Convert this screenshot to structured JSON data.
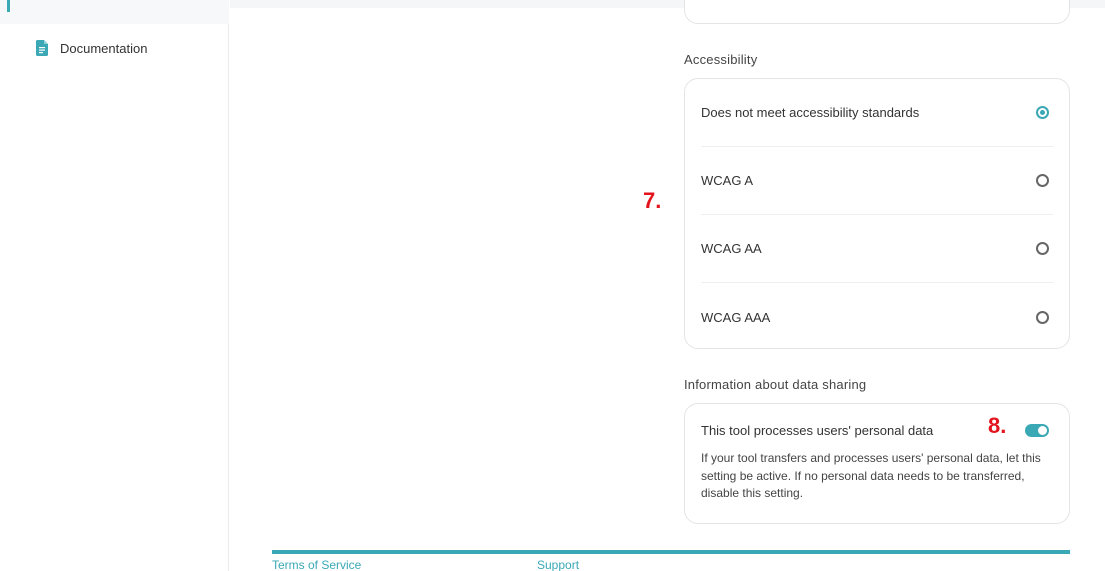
{
  "sidebar": {
    "items": [
      {
        "label": "Documentation",
        "icon": "document-icon"
      }
    ]
  },
  "accessibility": {
    "label": "Accessibility",
    "options": [
      {
        "label": "Does not meet accessibility standards",
        "selected": true
      },
      {
        "label": "WCAG A",
        "selected": false
      },
      {
        "label": "WCAG AA",
        "selected": false
      },
      {
        "label": "WCAG AAA",
        "selected": false
      }
    ]
  },
  "data_sharing": {
    "label": "Information about data sharing",
    "title": "This tool processes users' personal data",
    "toggle_on": true,
    "description": "If your tool transfers and processes users' personal data, let this setting be active. If no personal data needs to be transferred, disable this setting."
  },
  "annotations": {
    "step7": "7.",
    "step8": "8."
  },
  "footer": {
    "links": [
      "Terms of Service",
      "Support"
    ]
  },
  "colors": {
    "accent": "#3aa8b5",
    "annotation": "#e3141b"
  }
}
